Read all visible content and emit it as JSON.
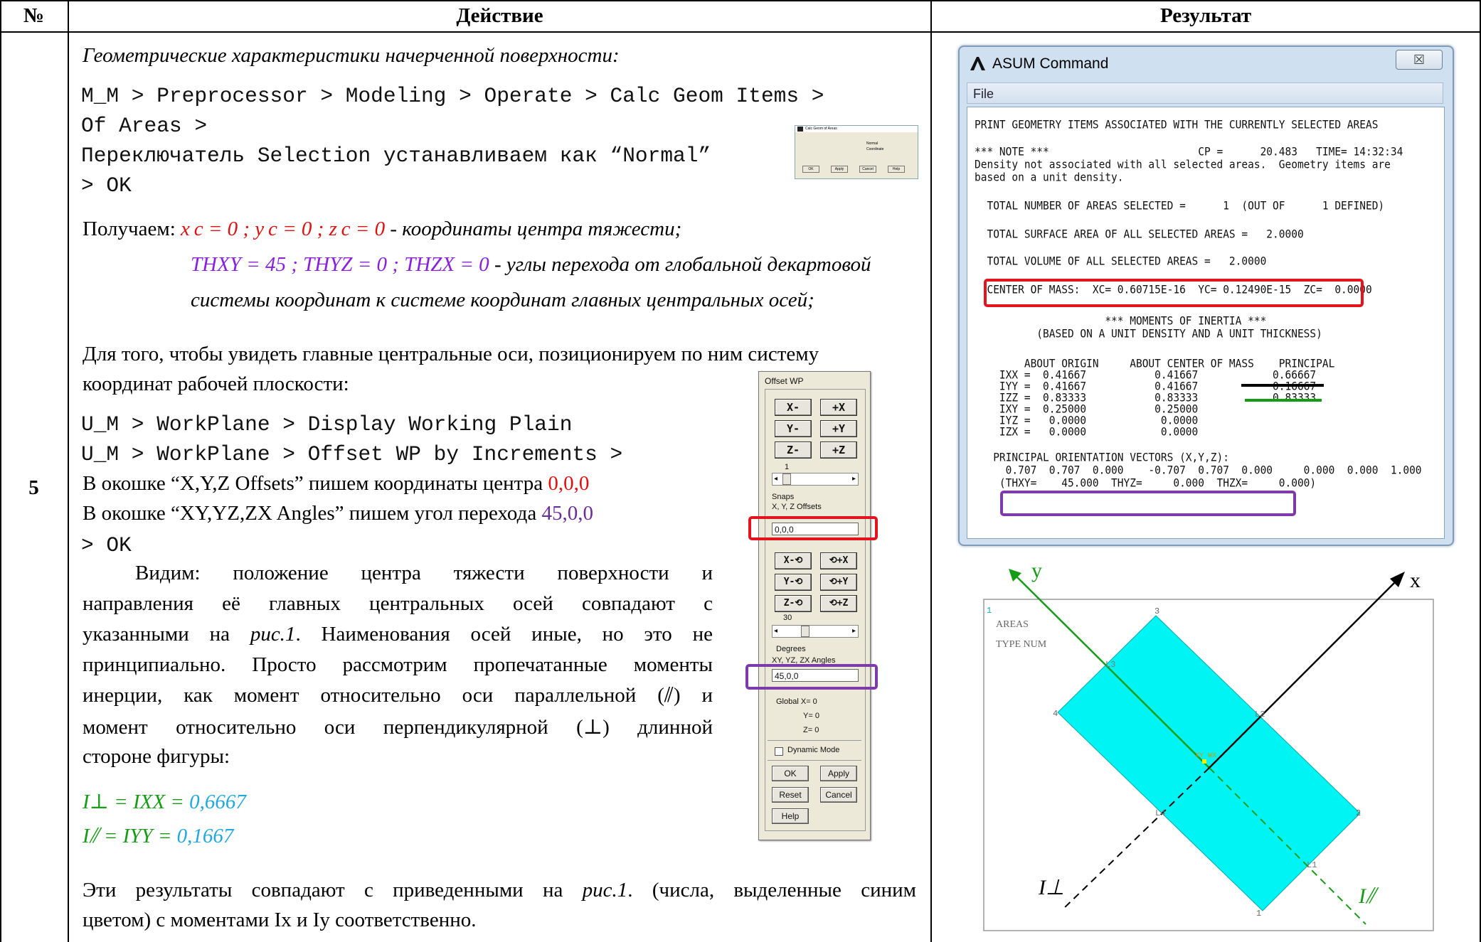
{
  "table": {
    "headers": {
      "num": "№",
      "action": "Действие",
      "result": "Результат"
    },
    "row_number": "5"
  },
  "action": {
    "intro": "Геометрические характеристики начерченной поверхности:",
    "path1_a": "M_M > Preprocessor > Modeling > Operate > Calc Geom Items >",
    "path1_b": "Of Areas >",
    "path1_c": "Переключатель Selection устанавливаем как “Normal”",
    "path1_d": "> OK",
    "get_prefix": "Получаем:",
    "centroid_eq": "x c = 0 ; y c = 0 ; z c = 0",
    "centroid_desc": " - координаты центра тяжести;",
    "angles_eq": "THXY = 45 ; THYZ = 0 ; THZX = 0",
    "angles_desc_a": " - углы перехода от глобальной декартовой",
    "angles_desc_b": "системы координат к системе координат главных центральных осей;",
    "wp_a": "Для того, чтобы увидеть главные центральные оси, позиционируем по ним систему",
    "wp_b": "координат рабочей плоскости:",
    "path2_a": "U_M > WorkPlane > Display Working Plain",
    "path2_b": "U_M > WorkPlane > Offset WP by Increments >",
    "offsets_text": "В окошке “X,Y,Z Offsets” пишем координаты центра ",
    "offsets_val": "0,0,0",
    "angles_text": "В окошке “XY,YZ,ZX Angles” пишем угол перехода ",
    "angles_val": "45,0,0",
    "ok": "> OK",
    "para_1": "Видим:   положение   центра   тяжести   поверхности   и",
    "para_2": "направления  её  главных  центральных  осей  совпадают  с",
    "para_3a": "указанными на ",
    "para_3b": "рис.1",
    "para_3c": ". Наименования осей иные, но это не",
    "para_4": "принципиально. Просто рассмотрим пропечатанные моменты",
    "para_5": "инерции, как момент относительно оси параллельной (⫽) и",
    "para_6": "момент  относительно  оси  перпендикулярной  (⊥)  длинной",
    "para_7": "стороне фигуры:",
    "i_perp_lhs": "I⊥ = IXX = ",
    "i_perp_val": "0,6667",
    "i_par_lhs": "I⫽ = IYY = ",
    "i_par_val": "0,1667",
    "concl_1a": "Эти результаты совпадают с приведенными на ",
    "concl_1b": "рис.1",
    "concl_1c": ". (числа, выделенные синим",
    "concl_2": "цветом) с моментами Ix и Iy соответственно."
  },
  "asum": {
    "title": "ASUM    Command",
    "close": "☒",
    "menu": "File",
    "lines": [
      "PRINT GEOMETRY ITEMS ASSOCIATED WITH THE CURRENTLY SELECTED AREAS",
      "*** NOTE ***                        CP =      20.483   TIME= 14:32:34",
      "Density not associated with all selected areas.  Geometry items are",
      "based on a unit density.",
      "  TOTAL NUMBER OF AREAS SELECTED =      1  (OUT OF      1 DEFINED)",
      "  TOTAL SURFACE AREA OF ALL SELECTED AREAS =   2.0000",
      "  TOTAL VOLUME OF ALL SELECTED AREAS =   2.0000",
      "  CENTER OF MASS:  XC= 0.60715E-16  YC= 0.12490E-15  ZC=  0.0000",
      "                     *** MOMENTS OF INERTIA ***",
      "          (BASED ON A UNIT DENSITY AND A UNIT THICKNESS)",
      "        ABOUT ORIGIN     ABOUT CENTER OF MASS    PRINCIPAL",
      "    IXX =  0.41667           0.41667            0.66667",
      "    IYY =  0.41667           0.41667            0.16667",
      "    IZZ =  0.83333           0.83333            0.83333",
      "    IXY =  0.25000           0.25000",
      "    IYZ =   0.0000            0.0000",
      "    IZX =   0.0000            0.0000",
      "   PRINCIPAL ORIENTATION VECTORS (X,Y,Z):",
      "     0.707  0.707  0.000    -0.707  0.707  0.000     0.000  0.000  1.000",
      "    (THXY=    45.000  THYZ=     0.000  THZX=     0.000)"
    ]
  },
  "offset_wp": {
    "title": "Offset WP",
    "xm": "X-",
    "xp": "+X",
    "ym": "Y-",
    "yp": "+Y",
    "zm": "Z-",
    "zp": "+Z",
    "step1": "1",
    "snaps": "Snaps",
    "offsets_label": "X, Y, Z Offsets",
    "offsets_value": "0,0,0",
    "rxm": "X-⟲",
    "rxp": "⟲+X",
    "rym": "Y-⟲",
    "ryp": "⟲+Y",
    "rzm": "Z-⟲",
    "rzp": "⟲+Z",
    "step2": "30",
    "degrees": "Degrees",
    "angles_label": "XY, YZ, ZX Angles",
    "angles_value": "45,0,0",
    "global_x": "Global X=   0",
    "global_y": "Y=   0",
    "global_z": "Z=   0",
    "dynamic": "Dynamic Mode",
    "ok": "OK",
    "apply": "Apply",
    "reset": "Reset",
    "cancel": "Cancel",
    "help": "Help"
  },
  "calc_dialog_thumb": {
    "title": "Calc Geom of Areas",
    "opt1": "Normal",
    "opt2": "Coordinate",
    "btns": [
      "OK",
      "Apply",
      "Cancel",
      "Help"
    ]
  },
  "plot": {
    "label_x": "x",
    "label_y": "y",
    "areas": "AREAS",
    "typenum": "TYPE NUM",
    "corner_num": "1",
    "i_perp": "I⊥",
    "i_par": "I⫽",
    "pts": [
      "1",
      "2",
      "3",
      "4"
    ],
    "lines": [
      "L1",
      "L2",
      "L3",
      "L4"
    ],
    "wp_label": "XY WX",
    "fill": "#00f4f4"
  }
}
